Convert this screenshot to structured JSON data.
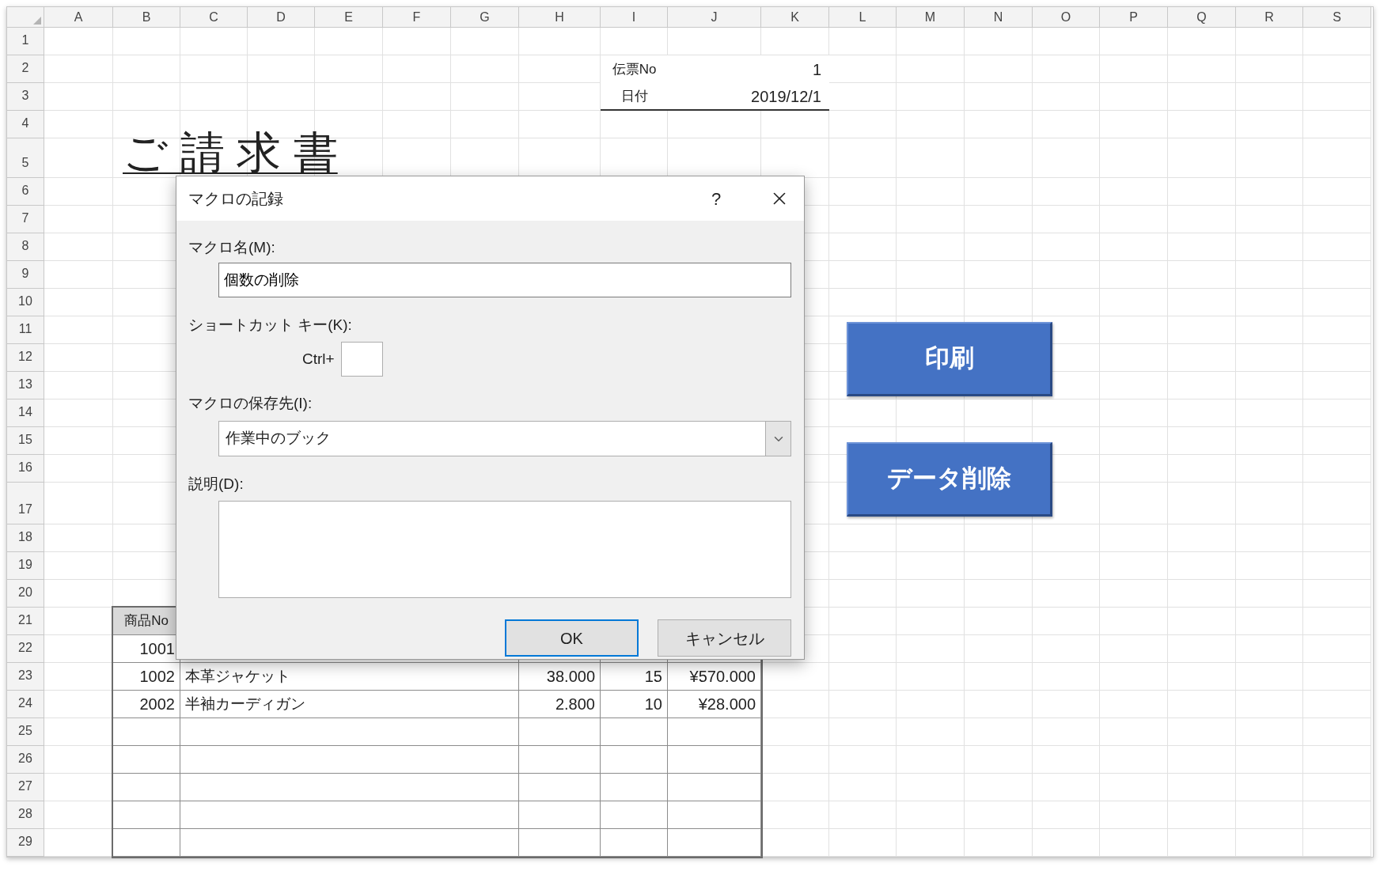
{
  "sheet": {
    "columns": [
      "A",
      "B",
      "C",
      "D",
      "E",
      "F",
      "G",
      "H",
      "I",
      "J",
      "K",
      "L",
      "M",
      "N",
      "O",
      "P",
      "Q",
      "R",
      "S"
    ],
    "rows": [
      "1",
      "2",
      "3",
      "4",
      "5",
      "6",
      "7",
      "8",
      "9",
      "10",
      "11",
      "12",
      "13",
      "14",
      "15",
      "16",
      "17",
      "18",
      "19",
      "20",
      "21",
      "22",
      "23",
      "24",
      "25",
      "26",
      "27",
      "28",
      "29"
    ]
  },
  "title": "ご 請 求 書",
  "slip": [
    {
      "label": "伝票No",
      "value": "1"
    },
    {
      "label": "日付",
      "value": "2019/12/1"
    }
  ],
  "items_table": {
    "columns": [
      "商品No"
    ],
    "rows": [
      {
        "no": "1001"
      },
      {
        "no": "1002",
        "name": "本革ジャケット",
        "price": "38.000",
        "qty": "15",
        "amount": "¥570.000"
      },
      {
        "no": "2002",
        "name": "半袖カーディガン",
        "price": "2.800",
        "qty": "10",
        "amount": "¥28.000"
      }
    ]
  },
  "shape_buttons": [
    "印刷",
    "データ削除"
  ],
  "dialog": {
    "title": "マクロの記録",
    "help": "?",
    "fields": [
      {
        "kind": "text",
        "label": "マクロ名(M):",
        "value": "個数の削除"
      },
      {
        "kind": "shortcut",
        "label": "ショートカット キー(K):",
        "prefix": "Ctrl+"
      },
      {
        "kind": "select",
        "label": "マクロの保存先(I):",
        "value": "作業中のブック"
      },
      {
        "kind": "textarea",
        "label": "説明(D):"
      }
    ],
    "buttons": [
      {
        "label": "OK",
        "default": true
      },
      {
        "label": "キャンセル",
        "default": false
      }
    ]
  }
}
